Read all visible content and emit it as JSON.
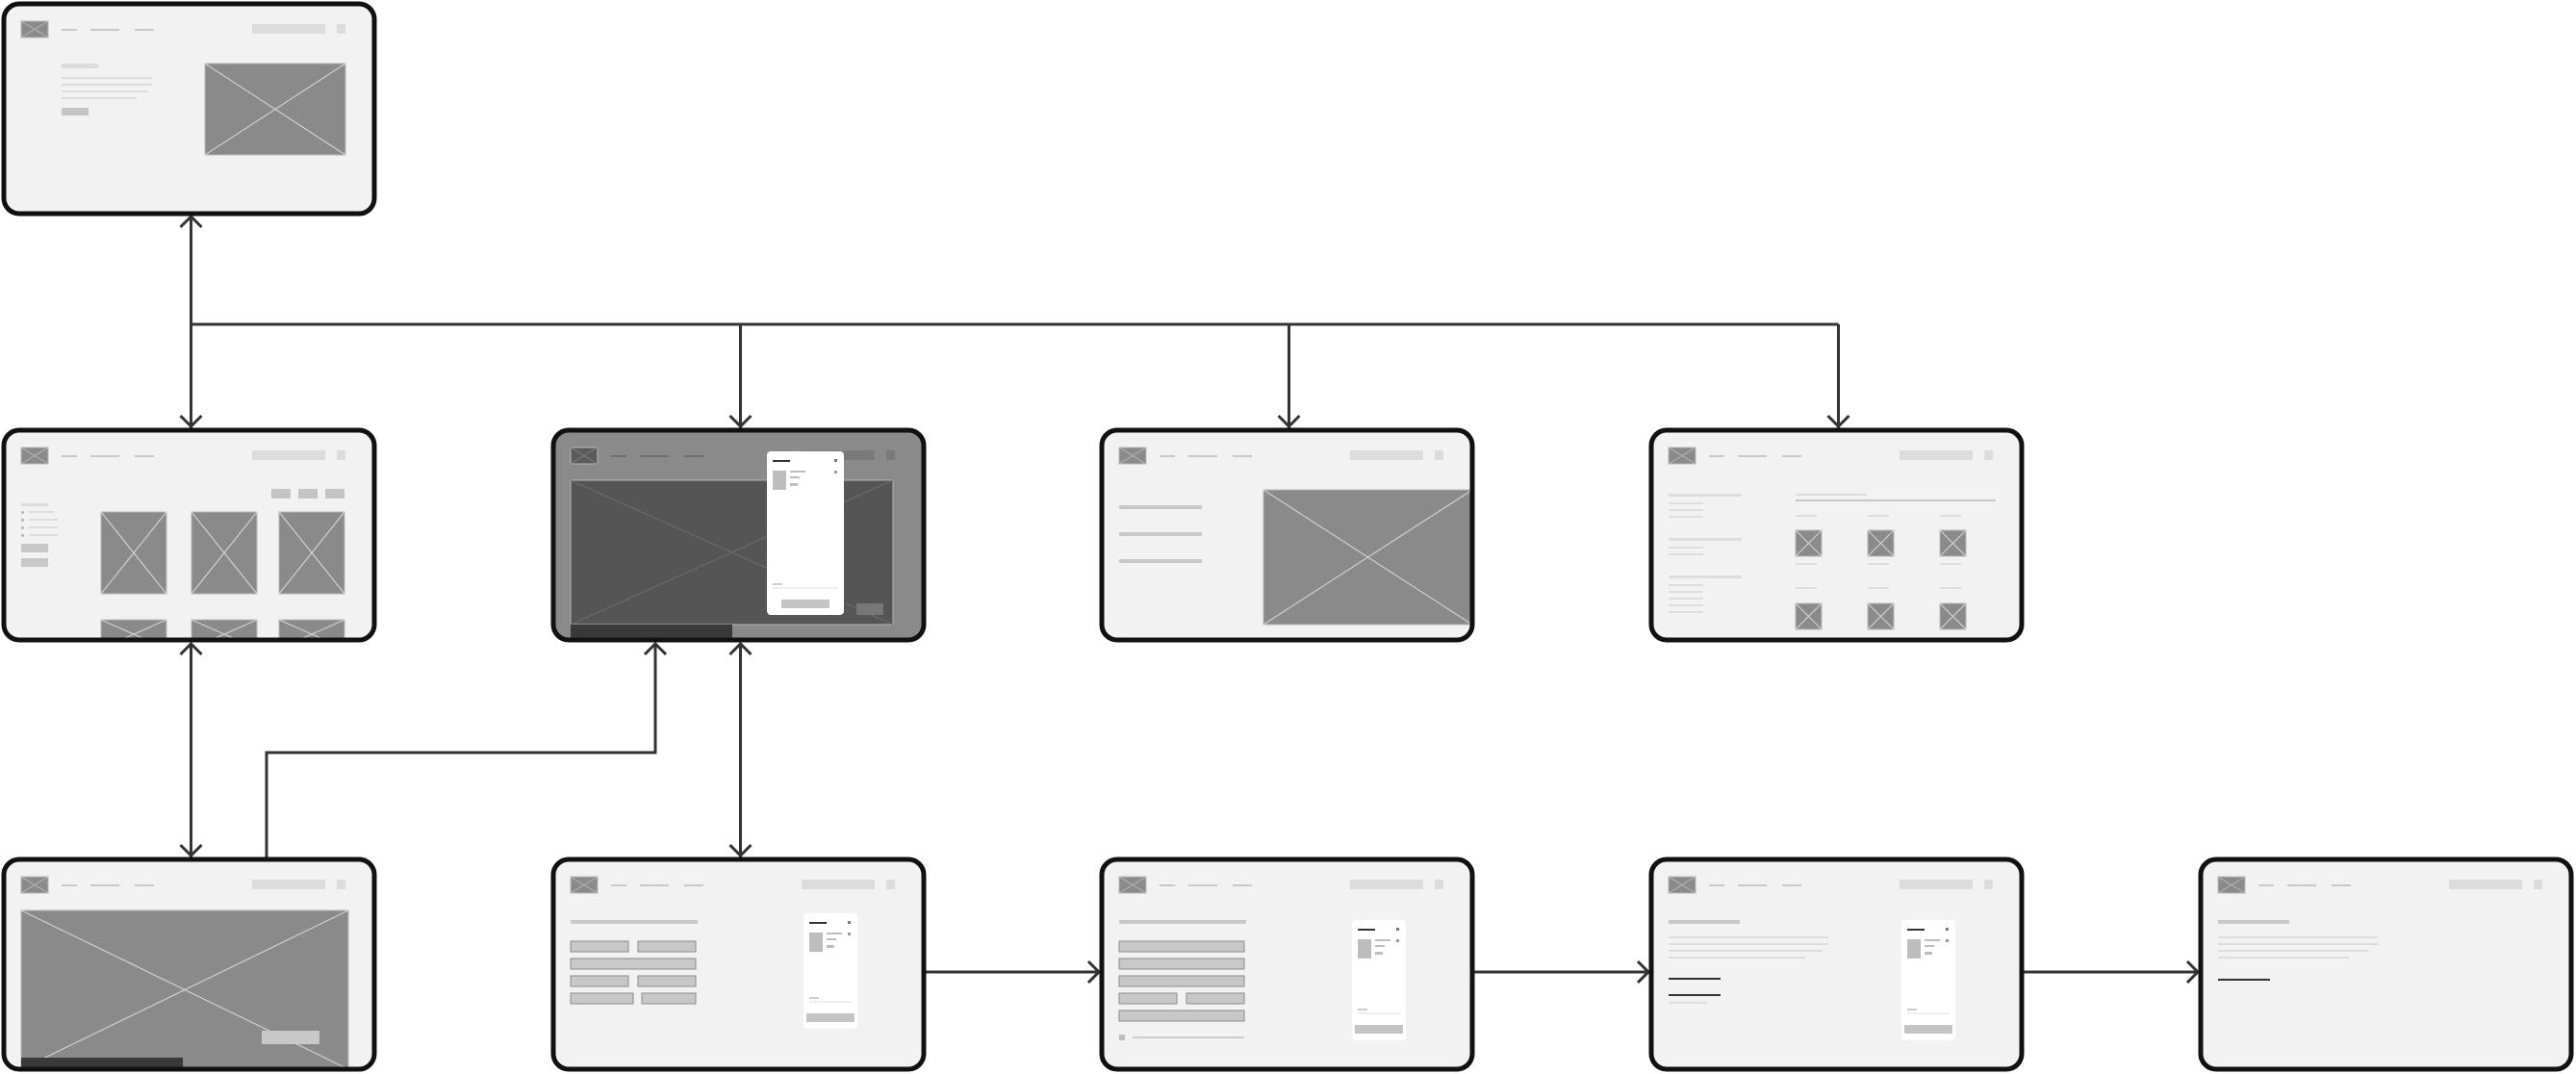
{
  "diagram": {
    "type": "site-map-wireframe-flow",
    "colors": {
      "frame_border": "#111111",
      "frame_fill": "#f2f2f2",
      "dark_frame_fill": "#8a8a8a",
      "placeholder_fill": "#8a8a8a",
      "placeholder_cross": "#cfcfcf",
      "skeleton_light": "#dcdcdc",
      "skeleton_mid": "#c4c4c4",
      "connector": "#333333",
      "modal_fill": "#ffffff"
    },
    "screens": [
      {
        "id": "home",
        "row": 0,
        "col": 0,
        "variant": "hero-split"
      },
      {
        "id": "listing",
        "row": 1,
        "col": 0,
        "variant": "product-grid"
      },
      {
        "id": "modal-over-media",
        "row": 1,
        "col": 1,
        "variant": "media-modal-dark"
      },
      {
        "id": "text-and-image",
        "row": 1,
        "col": 2,
        "variant": "text-image"
      },
      {
        "id": "icon-grid",
        "row": 1,
        "col": 3,
        "variant": "icon-grid"
      },
      {
        "id": "media-player",
        "row": 2,
        "col": 0,
        "variant": "media"
      },
      {
        "id": "form-step-1",
        "row": 2,
        "col": 1,
        "variant": "form-cart"
      },
      {
        "id": "form-step-2",
        "row": 2,
        "col": 2,
        "variant": "form-cart-checkbox"
      },
      {
        "id": "confirmation",
        "row": 2,
        "col": 3,
        "variant": "text-cart"
      },
      {
        "id": "final",
        "row": 2,
        "col": 4,
        "variant": "text-only"
      }
    ],
    "connections": [
      {
        "from": "home",
        "to": "listing",
        "style": "bidirectional"
      },
      {
        "from": "home",
        "to": "modal-over-media",
        "style": "one-way"
      },
      {
        "from": "home",
        "to": "text-and-image",
        "style": "one-way"
      },
      {
        "from": "home",
        "to": "icon-grid",
        "style": "one-way"
      },
      {
        "from": "listing",
        "to": "media-player",
        "style": "bidirectional"
      },
      {
        "from": "media-player",
        "to": "modal-over-media",
        "style": "one-way"
      },
      {
        "from": "modal-over-media",
        "to": "form-step-1",
        "style": "bidirectional"
      },
      {
        "from": "form-step-1",
        "to": "form-step-2",
        "style": "one-way"
      },
      {
        "from": "form-step-2",
        "to": "confirmation",
        "style": "one-way"
      },
      {
        "from": "confirmation",
        "to": "final",
        "style": "one-way"
      }
    ]
  }
}
